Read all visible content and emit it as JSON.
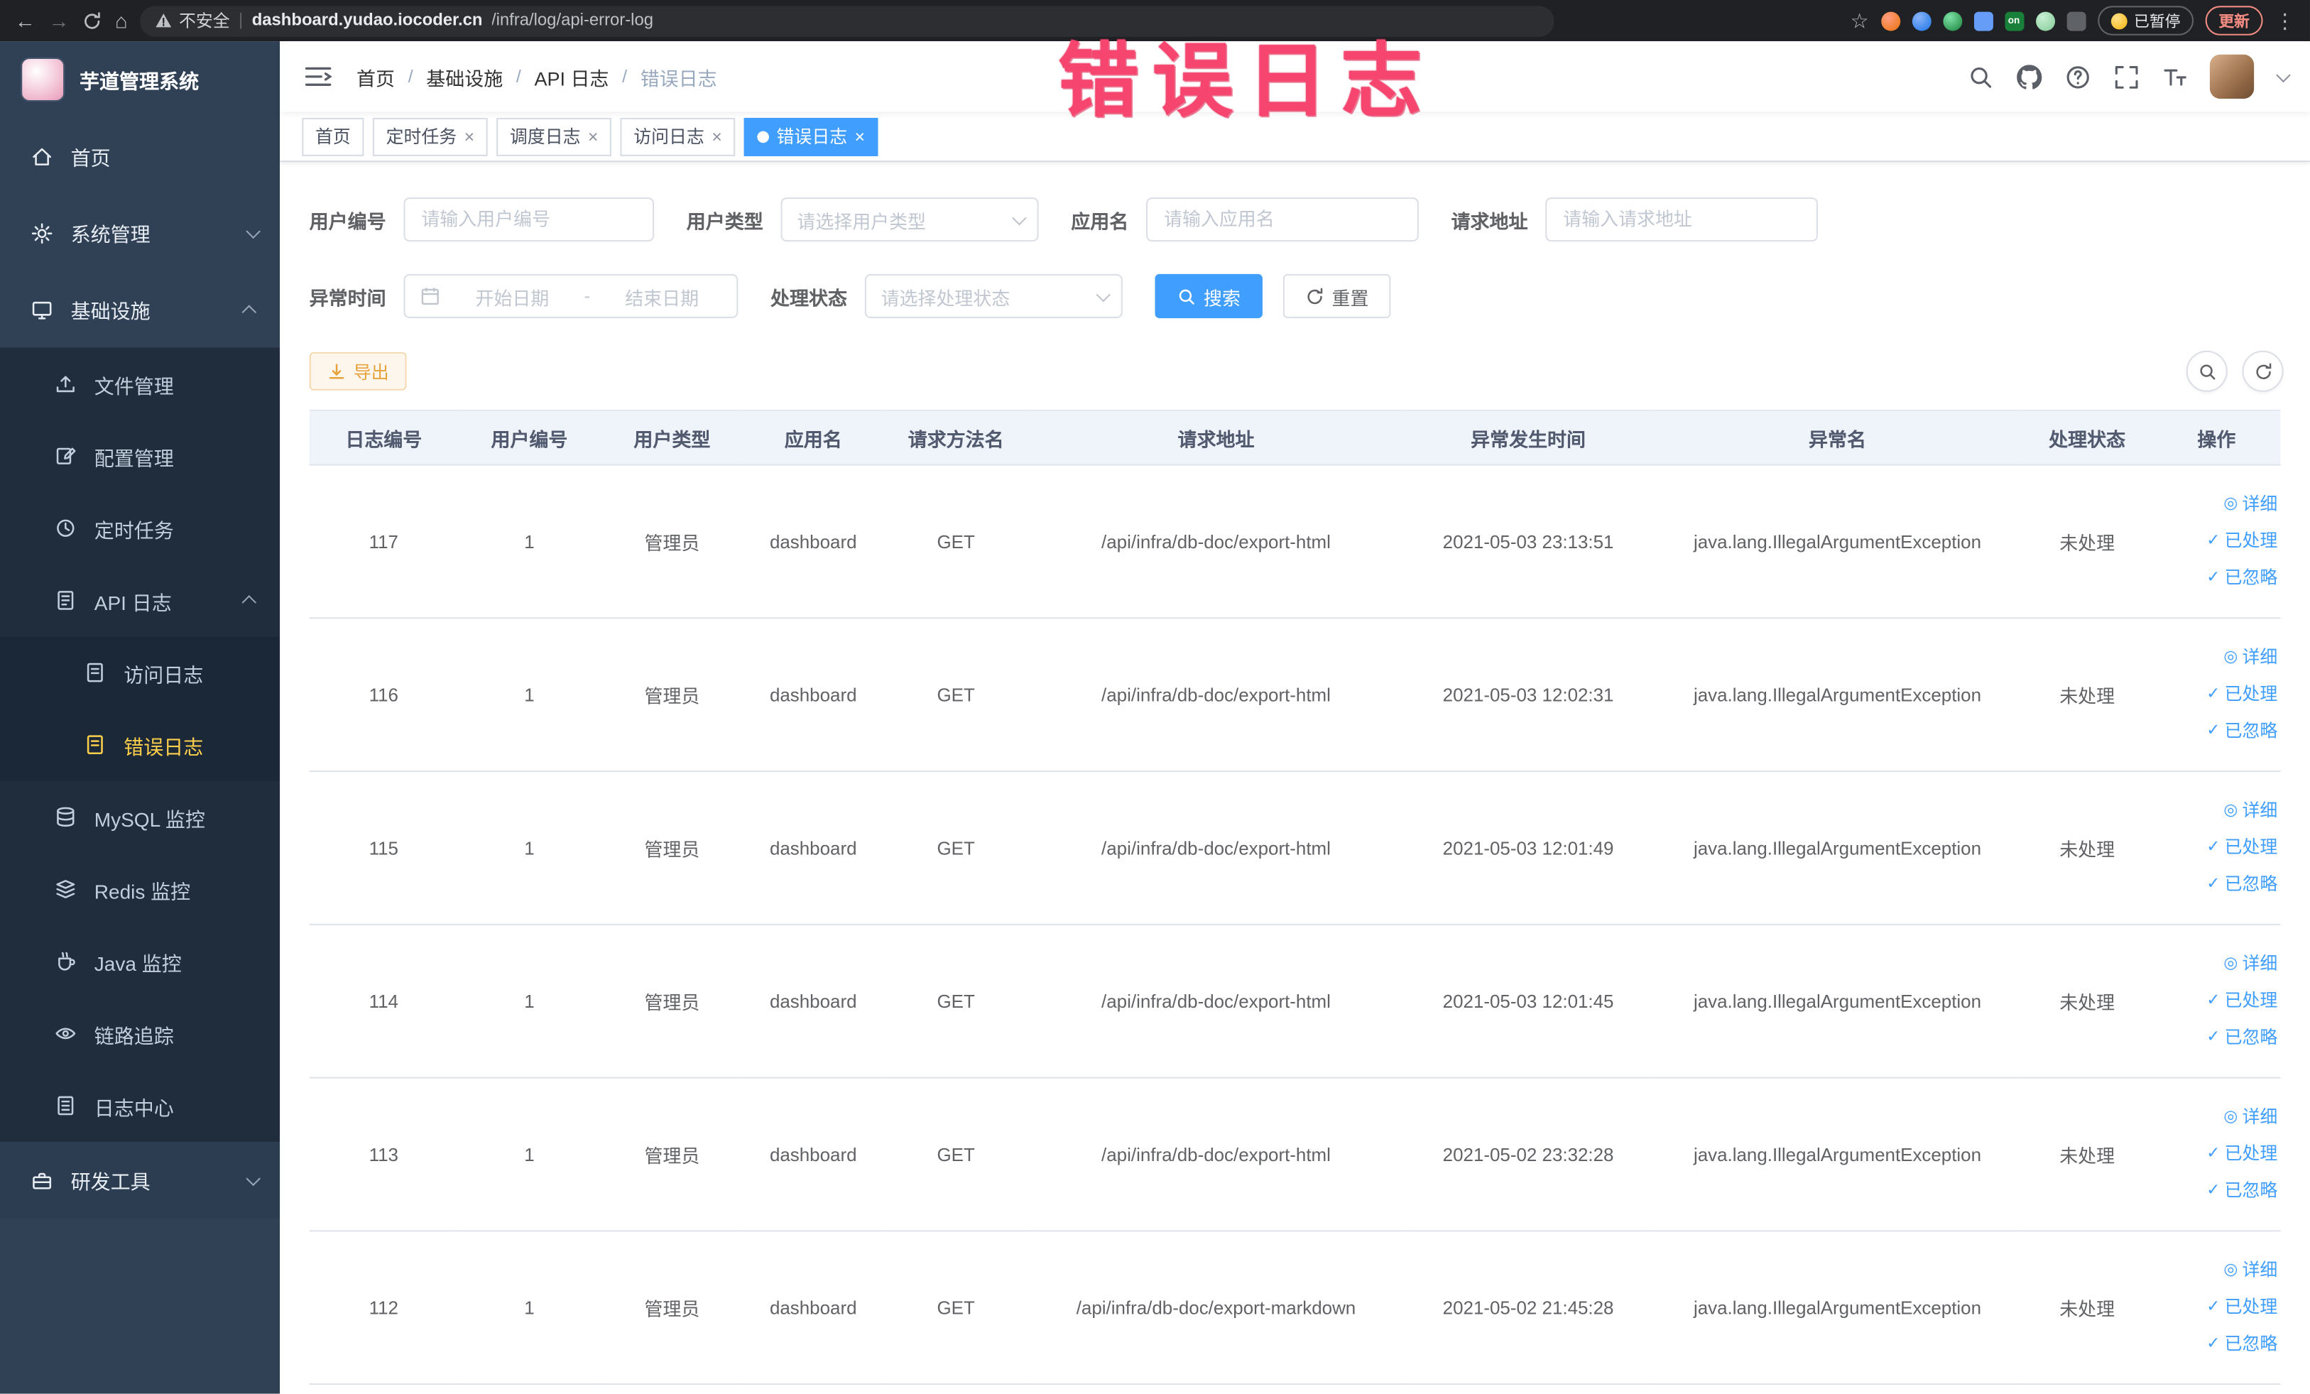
{
  "browser": {
    "security_label": "不安全",
    "url_host": "dashboard.yudao.iocoder.cn",
    "url_path": "/infra/log/api-error-log",
    "paused_badge": "已暂停",
    "update_button": "更新"
  },
  "glyphs": {
    "back": "←",
    "forward": "→",
    "home": "⌂",
    "star": "☆",
    "kebab": "⋮",
    "divider": "|",
    "close": "×",
    "check": "✓",
    "eye": "◎",
    "sep": "/"
  },
  "annotation": {
    "text": "错误日志"
  },
  "sidebar": {
    "logo_title": "芋道管理系统",
    "home": "首页",
    "system": "系统管理",
    "infra": "基础设施",
    "file": "文件管理",
    "config": "配置管理",
    "job": "定时任务",
    "api_log": "API 日志",
    "access_log": "访问日志",
    "error_log": "错误日志",
    "mysql": "MySQL 监控",
    "redis": "Redis 监控",
    "java": "Java 监控",
    "trace": "链路追踪",
    "log_center": "日志中心",
    "dev_tools": "研发工具"
  },
  "breadcrumb": {
    "home": "首页",
    "infra": "基础设施",
    "api_log": "API 日志",
    "current": "错误日志"
  },
  "tabs": {
    "home": "首页",
    "job": "定时任务",
    "job_log": "调度日志",
    "access_log": "访问日志",
    "error_log": "错误日志"
  },
  "filters": {
    "user_id_label": "用户编号",
    "user_id_placeholder": "请输入用户编号",
    "user_type_label": "用户类型",
    "user_type_placeholder": "请选择用户类型",
    "app_name_label": "应用名",
    "app_name_placeholder": "请输入应用名",
    "request_url_label": "请求地址",
    "request_url_placeholder": "请输入请求地址",
    "exception_time_label": "异常时间",
    "start_date_placeholder": "开始日期",
    "date_separator": "-",
    "end_date_placeholder": "结束日期",
    "process_status_label": "处理状态",
    "process_status_placeholder": "请选择处理状态",
    "search_button": "搜索",
    "reset_button": "重置"
  },
  "toolbar": {
    "export_button": "导出"
  },
  "table": {
    "columns": [
      "日志编号",
      "用户编号",
      "用户类型",
      "应用名",
      "请求方法名",
      "请求地址",
      "异常发生时间",
      "异常名",
      "处理状态",
      "操作"
    ],
    "actions": {
      "detail": "详细",
      "processed": "已处理",
      "ignored": "已忽略"
    },
    "rows": [
      {
        "id": "117",
        "user_id": "1",
        "user_type": "管理员",
        "app": "dashboard",
        "method": "GET",
        "url": "/api/infra/db-doc/export-html",
        "time": "2021-05-03 23:13:51",
        "exception": "java.lang.IllegalArgumentException",
        "status": "未处理"
      },
      {
        "id": "116",
        "user_id": "1",
        "user_type": "管理员",
        "app": "dashboard",
        "method": "GET",
        "url": "/api/infra/db-doc/export-html",
        "time": "2021-05-03 12:02:31",
        "exception": "java.lang.IllegalArgumentException",
        "status": "未处理"
      },
      {
        "id": "115",
        "user_id": "1",
        "user_type": "管理员",
        "app": "dashboard",
        "method": "GET",
        "url": "/api/infra/db-doc/export-html",
        "time": "2021-05-03 12:01:49",
        "exception": "java.lang.IllegalArgumentException",
        "status": "未处理"
      },
      {
        "id": "114",
        "user_id": "1",
        "user_type": "管理员",
        "app": "dashboard",
        "method": "GET",
        "url": "/api/infra/db-doc/export-html",
        "time": "2021-05-03 12:01:45",
        "exception": "java.lang.IllegalArgumentException",
        "status": "未处理"
      },
      {
        "id": "113",
        "user_id": "1",
        "user_type": "管理员",
        "app": "dashboard",
        "method": "GET",
        "url": "/api/infra/db-doc/export-html",
        "time": "2021-05-02 23:32:28",
        "exception": "java.lang.IllegalArgumentException",
        "status": "未处理"
      },
      {
        "id": "112",
        "user_id": "1",
        "user_type": "管理员",
        "app": "dashboard",
        "method": "GET",
        "url": "/api/infra/db-doc/export-markdown",
        "time": "2021-05-02 21:45:28",
        "exception": "java.lang.IllegalArgumentException",
        "status": "未处理"
      }
    ]
  }
}
